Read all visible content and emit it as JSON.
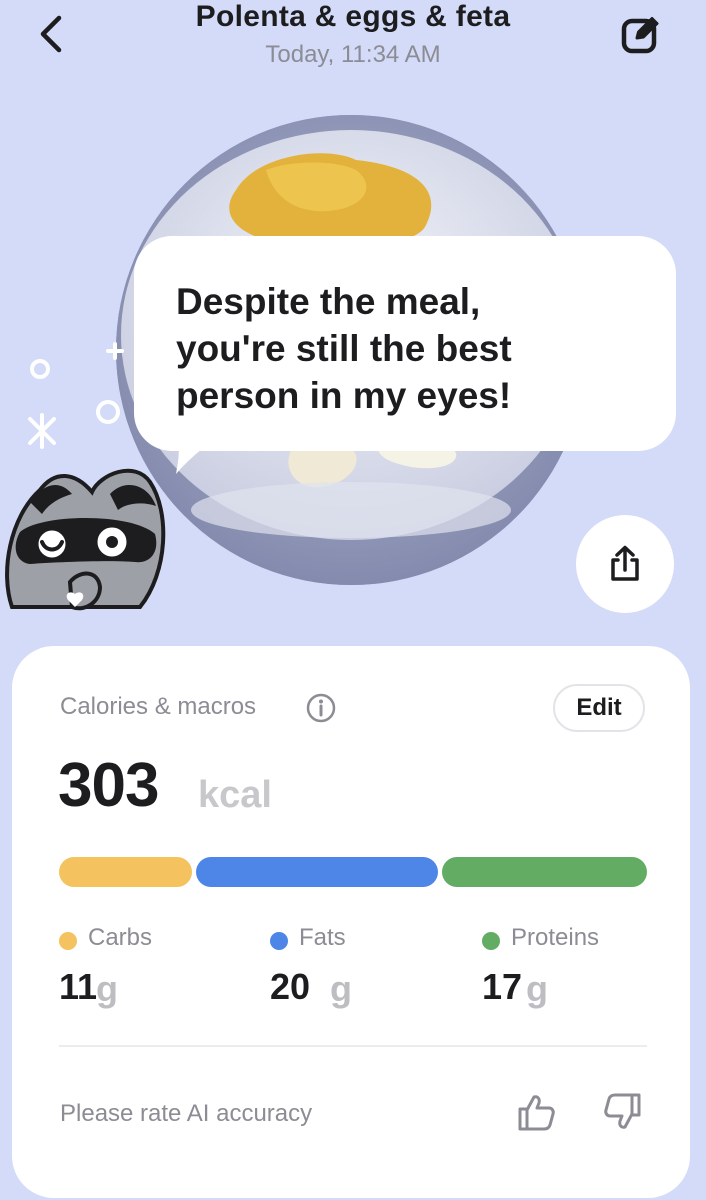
{
  "header": {
    "title": "Polenta & eggs & feta",
    "subtitle": "Today, 11:34 AM",
    "back_icon": "chevron-left-icon",
    "edit_icon": "pencil-square-icon"
  },
  "bubble": {
    "line1": "Despite the meal,",
    "line2": "you're still the best",
    "line3": "person in my eyes!"
  },
  "share": {
    "icon": "share-icon"
  },
  "card": {
    "label": "Calories & macros",
    "info_icon": "info-icon",
    "edit_label": "Edit",
    "calories": "303",
    "calories_unit": "kcal",
    "macros": [
      {
        "name": "Carbs",
        "value": "11",
        "unit": "g",
        "color": "#f4c25e"
      },
      {
        "name": "Fats",
        "value": "20",
        "unit": "g",
        "color": "#4d86e6"
      },
      {
        "name": "Proteins",
        "value": "17",
        "unit": "g",
        "color": "#62ad63"
      }
    ],
    "rate_label": "Please rate AI accuracy",
    "rate_icons": [
      "thumbs-up-icon",
      "thumbs-down-icon"
    ]
  },
  "colors": {
    "background": "#d3dbf8",
    "card": "#ffffff",
    "text": "#1d1d1f",
    "muted": "#8c8c94"
  }
}
